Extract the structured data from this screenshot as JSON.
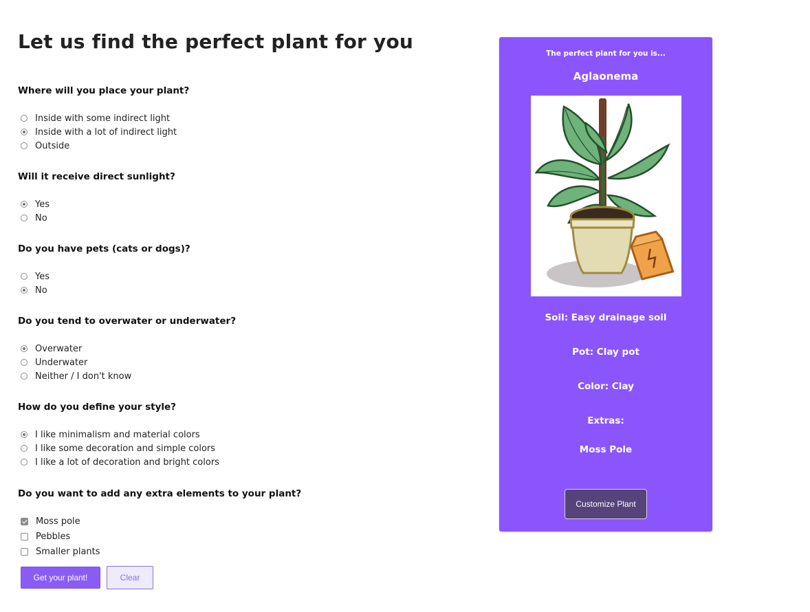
{
  "page_title": "Let us find the perfect plant for you",
  "questions": {
    "placement": {
      "label": "Where will you place your plant?",
      "options": [
        "Inside with some indirect light",
        "Inside with a lot of indirect light",
        "Outside"
      ],
      "selected": "Inside with a lot of indirect light"
    },
    "sunlight": {
      "label": "Will it receive direct sunlight?",
      "options": [
        "Yes",
        "No"
      ],
      "selected": "Yes"
    },
    "pets": {
      "label": "Do you have pets (cats or dogs)?",
      "options": [
        "Yes",
        "No"
      ],
      "selected": "No"
    },
    "watering": {
      "label": "Do you tend to overwater or underwater?",
      "options": [
        "Overwater",
        "Underwater",
        "Neither / I don't know"
      ],
      "selected": "Overwater"
    },
    "style": {
      "label": "How do you define your style?",
      "options": [
        "I like minimalism and material colors",
        "I like some decoration and simple colors",
        "I like a lot of decoration and bright colors"
      ],
      "selected": "I like minimalism and material colors"
    },
    "extras": {
      "label": "Do you want to add any extra elements to your plant?",
      "options": [
        "Moss pole",
        "Pebbles",
        "Smaller plants"
      ],
      "checked": [
        "Moss pole"
      ]
    }
  },
  "buttons": {
    "submit_label": "Get your plant!",
    "clear_label": "Clear"
  },
  "result": {
    "heading": "The perfect plant for you is...",
    "plant_name": "Aglaonema",
    "image_icon": "potted-plant-illustration",
    "soil": "Soil: Easy drainage soil",
    "pot": "Pot: Clay pot",
    "color": "Color: Clay",
    "extras_label": "Extras:",
    "extras_value": "Moss Pole",
    "customize_label": "Customize Plant"
  },
  "colors": {
    "accent": "#8b55fd",
    "button_primary": "#8a5cf6",
    "customize_button": "#55437a"
  }
}
